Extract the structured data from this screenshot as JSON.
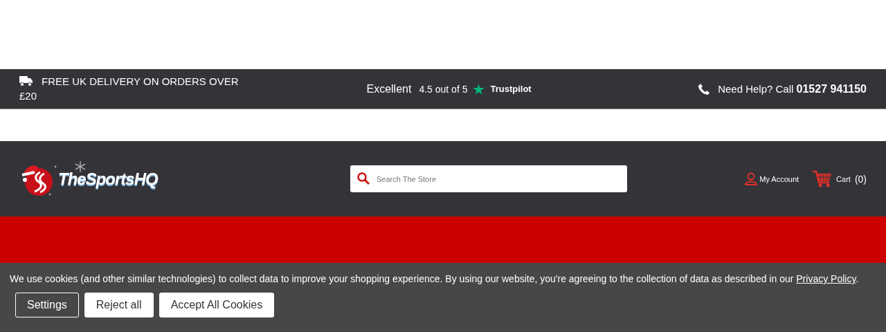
{
  "top_bar": {
    "delivery": "FREE UK DELIVERY ON ORDERS OVER £20",
    "rating": {
      "word": "Excellent",
      "score": "4.5 out of 5",
      "brand": "Trustpilot"
    },
    "help": {
      "label": "Need Help? Call",
      "phone": "01527 941150"
    }
  },
  "header": {
    "logo": "TheSportsHQ",
    "search": {
      "placeholder": "Search The Store"
    },
    "account": "My Account",
    "cart": {
      "label": "Cart",
      "count": "(0)"
    }
  },
  "cookie_banner": {
    "text": "We use cookies (and other similar technologies) to collect data to improve your shopping experience. By using our website, you're agreeing to the collection of data as described in our",
    "link": "Privacy Policy",
    "end": ".",
    "buttons": [
      {
        "label": "Settings",
        "kind": "outline"
      },
      {
        "label": "Reject all",
        "kind": "solid"
      },
      {
        "label": "Accept All Cookies",
        "kind": "solid"
      }
    ]
  }
}
